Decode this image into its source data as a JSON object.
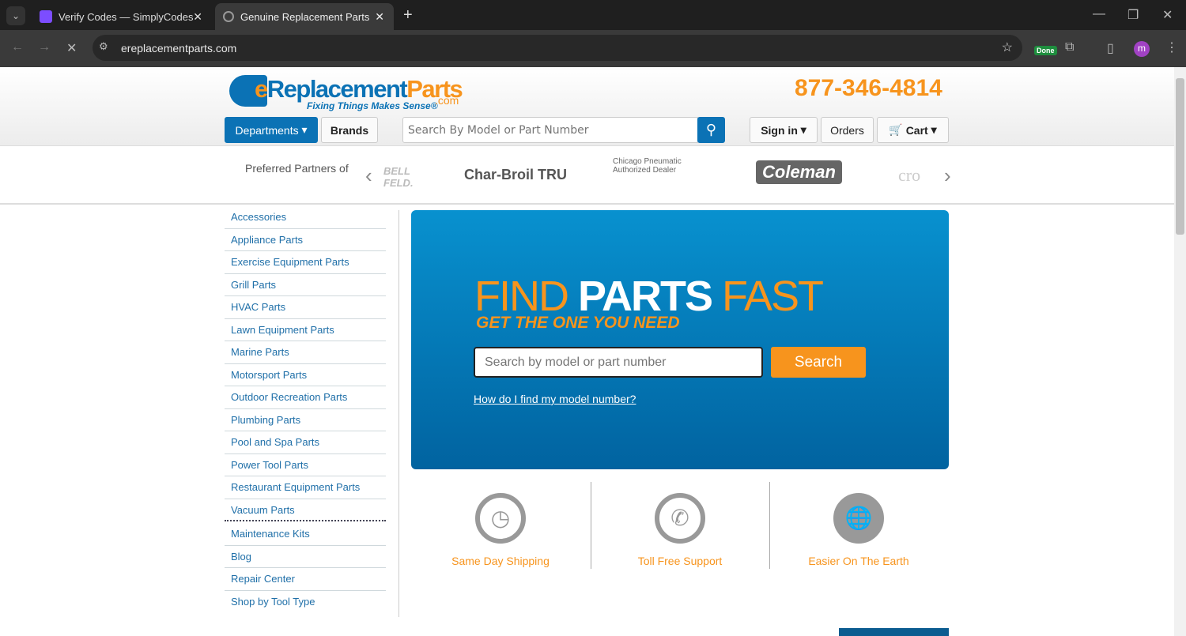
{
  "browser": {
    "tabs": [
      {
        "title": "Verify Codes — SimplyCodes"
      },
      {
        "title": "Genuine Replacement Parts | Fa"
      }
    ],
    "url": "ereplacementparts.com",
    "extension_badge": "Done",
    "profile_initial": "m"
  },
  "header": {
    "logo_text": "eReplacementParts",
    "logo_suffix": ".com",
    "tagline": "Fixing Things Makes Sense®",
    "phone": "877-346-4814",
    "departments": "Departments",
    "brands": "Brands",
    "search_placeholder": "Search By Model or Part Number",
    "sign_in": "Sign in",
    "orders": "Orders",
    "cart": "Cart"
  },
  "partners": {
    "label": "Preferred Partners of",
    "logos": [
      "BELL FELD.",
      "Char-Broil TRU",
      "Chicago Pneumatic Authorized Dealer",
      "Coleman",
      "cro"
    ]
  },
  "sidebar": {
    "items": [
      "Accessories",
      "Appliance Parts",
      "Exercise Equipment Parts",
      "Grill Parts",
      "HVAC Parts",
      "Lawn Equipment Parts",
      "Marine Parts",
      "Motorsport Parts",
      "Outdoor Recreation Parts",
      "Plumbing Parts",
      "Pool and Spa Parts",
      "Power Tool Parts",
      "Restaurant Equipment Parts",
      "Vacuum Parts"
    ],
    "extra": [
      "Maintenance Kits",
      "Blog",
      "Repair Center",
      "Shop by Tool Type"
    ]
  },
  "hero": {
    "find": "FIND ",
    "parts": "PARTS",
    "fast": " FAST",
    "subtitle": "GET THE ONE YOU NEED",
    "placeholder": "Search by model or part number",
    "search": "Search",
    "help_link": "How do I find my model number?"
  },
  "features": [
    {
      "label": "Same Day Shipping",
      "icon": "clock-truck"
    },
    {
      "label": "Toll Free Support",
      "icon": "phone"
    },
    {
      "label": "Easier On The Earth",
      "icon": "globe"
    }
  ],
  "colors": {
    "brand_blue": "#0b72b5",
    "orange": "#f7941d"
  }
}
